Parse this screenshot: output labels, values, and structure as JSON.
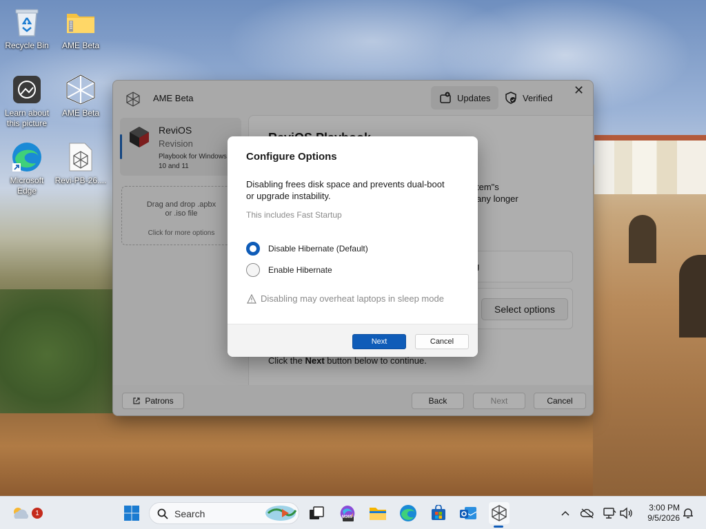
{
  "desktop": {
    "icons": [
      {
        "label": "Recycle Bin"
      },
      {
        "label": "AME Beta"
      },
      {
        "label": "Learn about this picture"
      },
      {
        "label": "AME Beta"
      },
      {
        "label": "Microsoft Edge"
      },
      {
        "label": "Revi-PB-26...."
      }
    ]
  },
  "window": {
    "title": "AME Beta",
    "updates_label": "Updates",
    "verified_label": "Verified",
    "sidebar": {
      "playbook_name": "ReviOS",
      "playbook_revision": "Revision",
      "playbook_desc": "Playbook for Windows 10 and 11",
      "drop_line1": "Drag and drop .apbx",
      "drop_line2": "or .iso file",
      "drop_more": "Click for more options"
    },
    "content": {
      "heading": "ReviOS Playbook",
      "frag_line1": "tem\"s",
      "frag_line2": "any longer",
      "card1_frag": "g",
      "select_options_label": "Select options",
      "footer_pre": "Click the ",
      "footer_bold": "Next",
      "footer_post": " button below to continue."
    },
    "buttons": {
      "patrons": "Patrons",
      "back": "Back",
      "next": "Next",
      "cancel": "Cancel"
    }
  },
  "dialog": {
    "title": "Configure Options",
    "description": "Disabling frees disk space and prevents dual-boot or upgrade instability.",
    "subtext": "This includes Fast Startup",
    "options": [
      {
        "label": "Disable Hibernate (Default)",
        "selected": true
      },
      {
        "label": "Enable Hibernate",
        "selected": false
      }
    ],
    "warning": "Disabling may overheat laptops in sleep mode",
    "next_label": "Next",
    "cancel_label": "Cancel"
  },
  "taskbar": {
    "weather_badge": "1",
    "search_placeholder": "Search",
    "m365_label": "M365",
    "time": "3:00 PM",
    "date": "9/5/2026"
  },
  "colors": {
    "accent": "#0f5cb8",
    "window_bg": "#f3f3f3",
    "dialog_bg": "#ffffff"
  }
}
